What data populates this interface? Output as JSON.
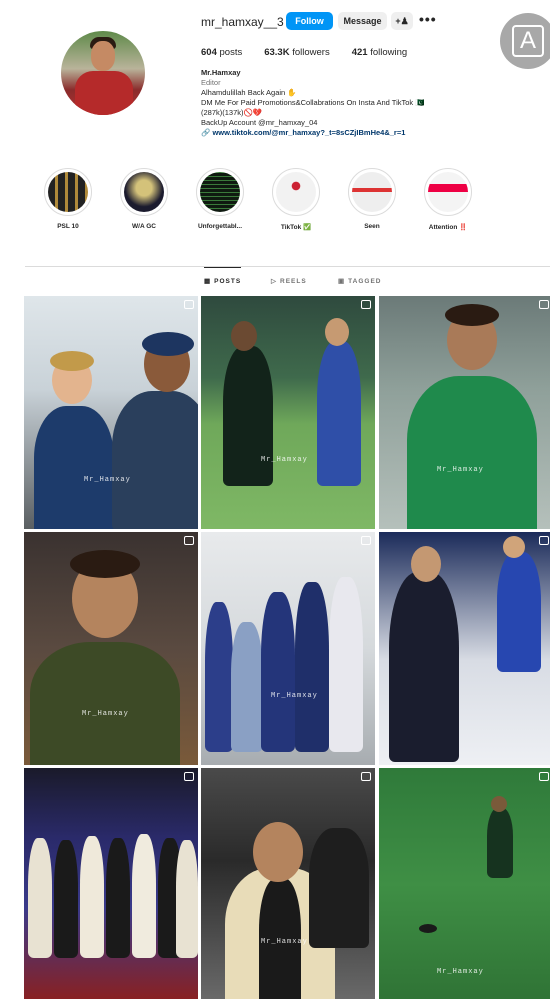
{
  "profile": {
    "username": "mr_hamxay__3",
    "follow_label": "Follow",
    "message_label": "Message",
    "add_user_icon": "+♟",
    "more_icon": "•••",
    "posts": "604",
    "posts_label": "posts",
    "followers": "63.3K",
    "followers_label": "followers",
    "following": "421",
    "following_label": "following"
  },
  "bio": {
    "name": "Mr.Hamxay",
    "category": "Editor",
    "line1": "Alhamdulillah Back Again ✋",
    "line2": "DM Me For Paid Promotions&Collabrations On Insta And TikTok 🇵🇰",
    "line3": "(287k)(137k)🚫💔",
    "line4": "BackUp Account @mr_hamxay_04",
    "link": "www.tiktok.com/@mr_hamxay?_t=8sCZjIBmHe4&_r=1"
  },
  "accessibility_button": "A",
  "highlights": [
    {
      "label": "PSL 10",
      "color": "#1a1a1a"
    },
    {
      "label": "W/A GC",
      "color": "#1b1b2e"
    },
    {
      "label": "Unforgettabl...",
      "color": "#0f1a10"
    },
    {
      "label": "TikTok ✅",
      "color": "#f2f2f2"
    },
    {
      "label": "Seen",
      "color": "#eeeeee"
    },
    {
      "label": "Attention ‼️",
      "color": "#f4f4f4"
    }
  ],
  "tabs": {
    "posts": "POSTS",
    "reels": "REELS",
    "tagged": "TAGGED"
  },
  "watermarks": {
    "tile1": "Mr_Hamxay",
    "tile2": "Mr_Hamxay",
    "tile3": "Mr_Hamxay",
    "tile4": "Mr_Hamxay",
    "tile5": "Mr_Hamxay",
    "tile8": "Mr_Hamxay",
    "tile9": "Mr_Hamxay"
  }
}
